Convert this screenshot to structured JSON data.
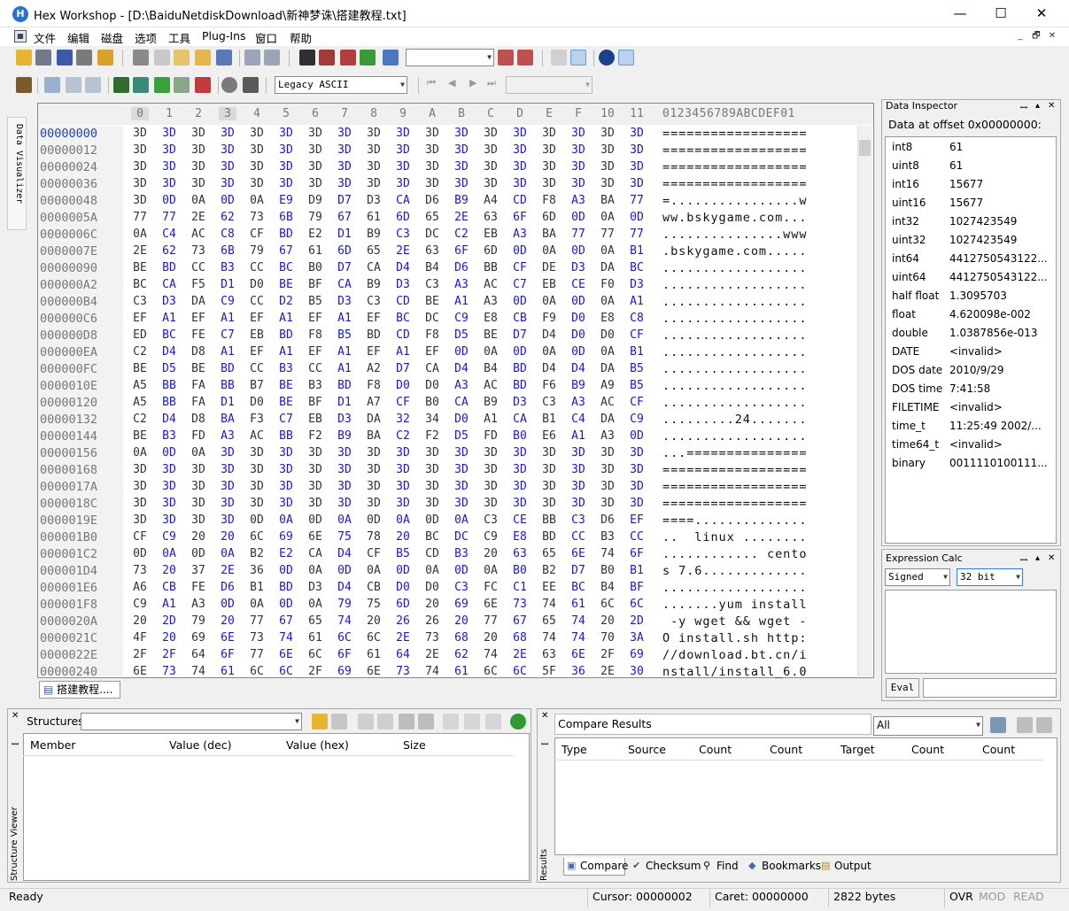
{
  "window": {
    "title": "Hex Workshop - [D:\\BaiduNetdiskDownload\\新神梦诛\\搭建教程.txt]",
    "minimize": "—",
    "maximize": "☐",
    "close": "✕"
  },
  "menu": [
    "文件",
    "编辑",
    "磁盘",
    "选项",
    "工具",
    "Plug-Ins",
    "窗口",
    "帮助"
  ],
  "mdi_controls": [
    "_",
    "🗗",
    "✕"
  ],
  "toolbar2": {
    "encoding": "Legacy ASCII"
  },
  "side_tab": "Data Visualizer",
  "hex": {
    "col_headers": [
      "0",
      "1",
      "2",
      "3",
      "4",
      "5",
      "6",
      "7",
      "8",
      "9",
      "A",
      "B",
      "C",
      "D",
      "E",
      "F",
      "10",
      "11"
    ],
    "ascii_header": "0123456789ABCDEF01",
    "rows": [
      {
        "off": "00000000",
        "bytes": "3D 3D 3D 3D 3D 3D 3D 3D 3D 3D 3D 3D 3D 3D 3D 3D 3D 3D",
        "ascii": "=================="
      },
      {
        "off": "00000012",
        "bytes": "3D 3D 3D 3D 3D 3D 3D 3D 3D 3D 3D 3D 3D 3D 3D 3D 3D 3D",
        "ascii": "=================="
      },
      {
        "off": "00000024",
        "bytes": "3D 3D 3D 3D 3D 3D 3D 3D 3D 3D 3D 3D 3D 3D 3D 3D 3D 3D",
        "ascii": "=================="
      },
      {
        "off": "00000036",
        "bytes": "3D 3D 3D 3D 3D 3D 3D 3D 3D 3D 3D 3D 3D 3D 3D 3D 3D 3D",
        "ascii": "=================="
      },
      {
        "off": "00000048",
        "bytes": "3D 0D 0A 0D 0A E9 D9 D7 D3 CA D6 B9 A4 CD F8 A3 BA 77",
        "ascii": "=................w"
      },
      {
        "off": "0000005A",
        "bytes": "77 77 2E 62 73 6B 79 67 61 6D 65 2E 63 6F 6D 0D 0A 0D",
        "ascii": "ww.bskygame.com..."
      },
      {
        "off": "0000006C",
        "bytes": "0A C4 AC C8 CF BD E2 D1 B9 C3 DC C2 EB A3 BA 77 77 77",
        "ascii": "...............www"
      },
      {
        "off": "0000007E",
        "bytes": "2E 62 73 6B 79 67 61 6D 65 2E 63 6F 6D 0D 0A 0D 0A B1",
        "ascii": ".bskygame.com....."
      },
      {
        "off": "00000090",
        "bytes": "BE BD CC B3 CC BC B0 D7 CA D4 B4 D6 BB CF DE D3 DA BC",
        "ascii": ".................."
      },
      {
        "off": "000000A2",
        "bytes": "BC CA F5 D1 D0 BE BF CA B9 D3 C3 A3 AC C7 EB CE F0 D3",
        "ascii": ".................."
      },
      {
        "off": "000000B4",
        "bytes": "C3 D3 DA C9 CC D2 B5 D3 C3 CD BE A1 A3 0D 0A 0D 0A A1",
        "ascii": ".................."
      },
      {
        "off": "000000C6",
        "bytes": "EF A1 EF A1 EF A1 EF A1 EF BC DC C9 E8 CB F9 D0 E8 C8",
        "ascii": ".................."
      },
      {
        "off": "000000D8",
        "bytes": "ED BC FE C7 EB BD F8 B5 BD CD F8 D5 BE D7 D4 D0 D0 CF",
        "ascii": ".................."
      },
      {
        "off": "000000EA",
        "bytes": "C2 D4 D8 A1 EF A1 EF A1 EF A1 EF 0D 0A 0D 0A 0D 0A B1",
        "ascii": ".................."
      },
      {
        "off": "000000FC",
        "bytes": "BE D5 BE BD CC B3 CC A1 A2 D7 CA D4 B4 BD D4 D4 DA B5",
        "ascii": ".................."
      },
      {
        "off": "0000010E",
        "bytes": "A5 BB FA BB B7 BE B3 BD F8 D0 D0 A3 AC BD F6 B9 A9 B5",
        "ascii": ".................."
      },
      {
        "off": "00000120",
        "bytes": "A5 BB FA D1 D0 BE BF D1 A7 CF B0 CA B9 D3 C3 A3 AC CF",
        "ascii": ".................."
      },
      {
        "off": "00000132",
        "bytes": "C2 D4 D8 BA F3 C7 EB D3 DA 32 34 D0 A1 CA B1 C4 DA C9",
        "ascii": ".........24......."
      },
      {
        "off": "00000144",
        "bytes": "BE B3 FD A3 AC BB F2 B9 BA C2 F2 D5 FD B0 E6 A1 A3 0D",
        "ascii": ".................."
      },
      {
        "off": "00000156",
        "bytes": "0A 0D 0A 3D 3D 3D 3D 3D 3D 3D 3D 3D 3D 3D 3D 3D 3D 3D",
        "ascii": "...==============="
      },
      {
        "off": "00000168",
        "bytes": "3D 3D 3D 3D 3D 3D 3D 3D 3D 3D 3D 3D 3D 3D 3D 3D 3D 3D",
        "ascii": "=================="
      },
      {
        "off": "0000017A",
        "bytes": "3D 3D 3D 3D 3D 3D 3D 3D 3D 3D 3D 3D 3D 3D 3D 3D 3D 3D",
        "ascii": "=================="
      },
      {
        "off": "0000018C",
        "bytes": "3D 3D 3D 3D 3D 3D 3D 3D 3D 3D 3D 3D 3D 3D 3D 3D 3D 3D",
        "ascii": "=================="
      },
      {
        "off": "0000019E",
        "bytes": "3D 3D 3D 3D 0D 0A 0D 0A 0D 0A 0D 0A C3 CE BB C3 D6 EF",
        "ascii": "====.............."
      },
      {
        "off": "000001B0",
        "bytes": "CF C9 20 20 6C 69 6E 75 78 20 BC DC C9 E8 BD CC B3 CC",
        "ascii": "..  linux ........"
      },
      {
        "off": "000001C2",
        "bytes": "0D 0A 0D 0A B2 E2 CA D4 CF B5 CD B3 20 63 65 6E 74 6F",
        "ascii": "............ cento"
      },
      {
        "off": "000001D4",
        "bytes": "73 20 37 2E 36 0D 0A 0D 0A 0D 0A 0D 0A B0 B2 D7 B0 B1",
        "ascii": "s 7.6............."
      },
      {
        "off": "000001E6",
        "bytes": "A6 CB FE D6 B1 BD D3 D4 CB D0 D0 C3 FC C1 EE BC B4 BF",
        "ascii": ".................."
      },
      {
        "off": "000001F8",
        "bytes": "C9 A1 A3 0D 0A 0D 0A 79 75 6D 20 69 6E 73 74 61 6C 6C",
        "ascii": ".......yum install"
      },
      {
        "off": "0000020A",
        "bytes": "20 2D 79 20 77 67 65 74 20 26 26 20 77 67 65 74 20 2D",
        "ascii": " -y wget && wget -"
      },
      {
        "off": "0000021C",
        "bytes": "4F 20 69 6E 73 74 61 6C 6C 2E 73 68 20 68 74 74 70 3A",
        "ascii": "O install.sh http:"
      },
      {
        "off": "0000022E",
        "bytes": "2F 2F 64 6F 77 6E 6C 6F 61 64 2E 62 74 2E 63 6E 2F 69",
        "ascii": "//download.bt.cn/i"
      },
      {
        "off": "00000240",
        "bytes": "6E 73 74 61 6C 6C 2F 69 6E 73 74 61 6C 6C 5F 36 2E 30",
        "ascii": "nstall/install_6.0"
      }
    ]
  },
  "doc_tab": "搭建教程....",
  "data_inspector": {
    "title": "Data Inspector",
    "header": "Data at offset 0x00000000:",
    "rows": [
      {
        "k": "int8",
        "v": "61"
      },
      {
        "k": "uint8",
        "v": "61"
      },
      {
        "k": "int16",
        "v": "15677"
      },
      {
        "k": "uint16",
        "v": "15677"
      },
      {
        "k": "int32",
        "v": "1027423549"
      },
      {
        "k": "uint32",
        "v": "1027423549"
      },
      {
        "k": "int64",
        "v": "4412750543122..."
      },
      {
        "k": "uint64",
        "v": "4412750543122..."
      },
      {
        "k": "half float",
        "v": "1.3095703"
      },
      {
        "k": "float",
        "v": "4.620098e-002"
      },
      {
        "k": "double",
        "v": "1.0387856e-013"
      },
      {
        "k": "DATE",
        "v": "<invalid>"
      },
      {
        "k": "DOS date",
        "v": "2010/9/29"
      },
      {
        "k": "DOS time",
        "v": "7:41:58"
      },
      {
        "k": "FILETIME",
        "v": "<invalid>"
      },
      {
        "k": "time_t",
        "v": "11:25:49 2002/..."
      },
      {
        "k": "time64_t",
        "v": "<invalid>"
      },
      {
        "k": "binary",
        "v": "0011110100111..."
      }
    ]
  },
  "expr_calc": {
    "title": "Expression Calc",
    "sign": "Signed",
    "bits": "32 bit",
    "eval": "Eval"
  },
  "structures": {
    "title": "Structures",
    "cols": [
      "Member",
      "Value (dec)",
      "Value (hex)",
      "Size"
    ],
    "side_label": "Structure Viewer"
  },
  "compare": {
    "title": "Compare Results",
    "filter": "All",
    "cols": [
      "Type",
      "Source",
      "Count",
      "Count",
      "Target",
      "Count",
      "Count"
    ],
    "side_label": "Results",
    "tabs": [
      "Compare",
      "Checksum",
      "Find",
      "Bookmarks",
      "Output"
    ]
  },
  "status": {
    "ready": "Ready",
    "cursor": "Cursor: 00000002",
    "caret": "Caret: 00000000",
    "size": "2822 bytes",
    "ovr": "OVR",
    "mod": "MOD",
    "read": "READ"
  }
}
